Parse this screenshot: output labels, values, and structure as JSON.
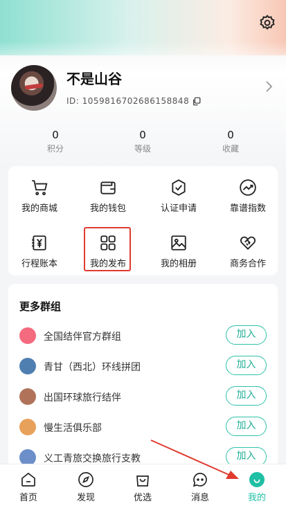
{
  "profile": {
    "name": "不是山谷",
    "id_text": "ID: 1059816702686158848"
  },
  "stats": [
    {
      "value": "0",
      "label": "积分"
    },
    {
      "value": "0",
      "label": "等级"
    },
    {
      "value": "0",
      "label": "收藏"
    }
  ],
  "services": [
    {
      "label": "我的商城",
      "icon": "cart-icon"
    },
    {
      "label": "我的钱包",
      "icon": "wallet-icon"
    },
    {
      "label": "认证申请",
      "icon": "verified-shield-icon"
    },
    {
      "label": "靠谱指数",
      "icon": "trend-icon"
    },
    {
      "label": "行程账本",
      "icon": "ledger-yen-icon"
    },
    {
      "label": "我的发布",
      "icon": "grid-icon"
    },
    {
      "label": "我的相册",
      "icon": "image-icon"
    },
    {
      "label": "商务合作",
      "icon": "handshake-icon"
    }
  ],
  "groups": {
    "title": "更多群组",
    "join_label": "加入",
    "items": [
      {
        "name": "全国结伴官方群组",
        "color": "#f46a7e"
      },
      {
        "name": "青甘（西北）环线拼团",
        "color": "#4f7fb0"
      },
      {
        "name": "出国环球旅行结伴",
        "color": "#b0735a"
      },
      {
        "name": "慢生活俱乐部",
        "color": "#e8a15a"
      },
      {
        "name": "义工青旅交换旅行支教",
        "color": "#6c8fc9"
      }
    ]
  },
  "tabs": [
    {
      "label": "首页",
      "icon": "home-icon"
    },
    {
      "label": "发现",
      "icon": "compass-icon"
    },
    {
      "label": "优选",
      "icon": "bag-icon"
    },
    {
      "label": "消息",
      "icon": "message-icon"
    },
    {
      "label": "我的",
      "icon": "profile-icon",
      "active": true
    }
  ],
  "colors": {
    "accent": "#1fbfa4",
    "highlight": "#e03a2e"
  }
}
